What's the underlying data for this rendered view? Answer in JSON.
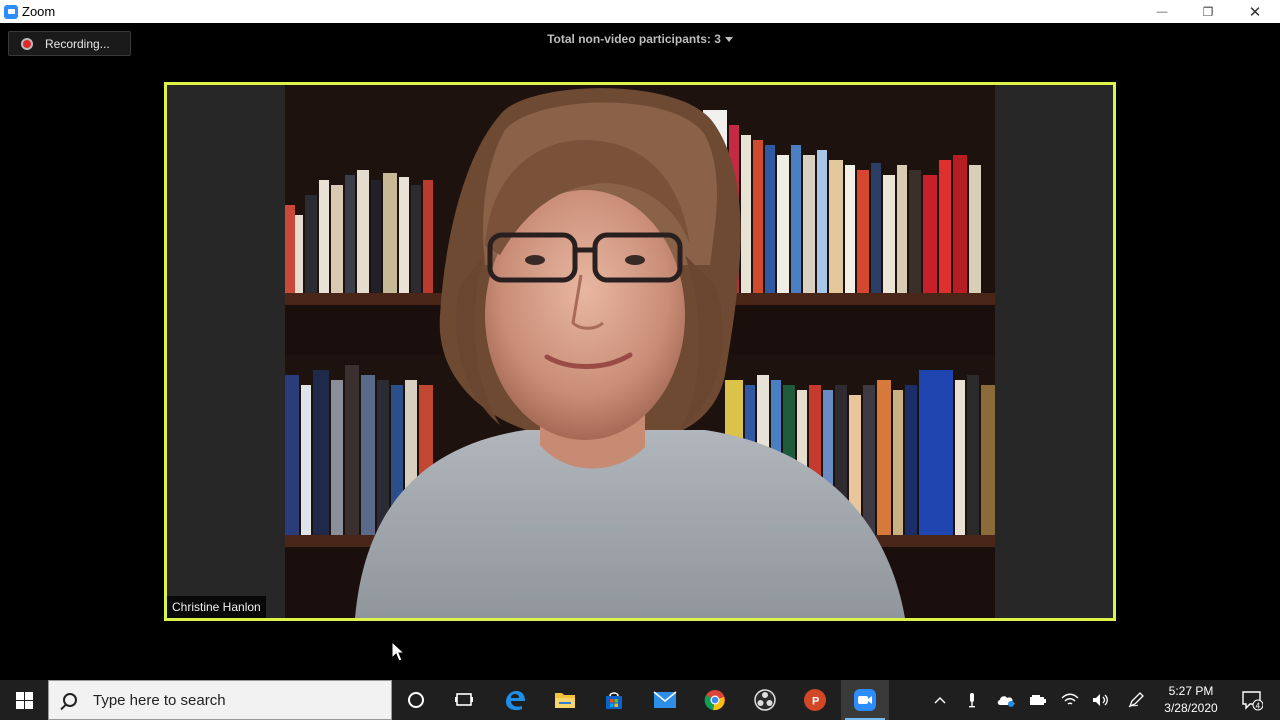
{
  "window": {
    "title": "Zoom",
    "minimize_glyph": "—",
    "restore_glyph": "❐",
    "close_glyph": "✕"
  },
  "meeting": {
    "recording_label": "Recording...",
    "participants_text": "Total non-video participants: 3",
    "speaker_name": "Christine Hanlon",
    "active_speaker_border_color": "#ddf34a"
  },
  "taskbar": {
    "search_placeholder": "Type here to search",
    "apps": [
      "cortana-icon",
      "task-view-icon",
      "edge-icon",
      "file-explorer-icon",
      "store-icon",
      "mail-icon",
      "chrome-icon",
      "obs-icon",
      "powerpoint-icon",
      "zoom-icon"
    ],
    "active_app": "zoom-icon",
    "powerpoint_letter": "P",
    "clock_time": "5:27 PM",
    "clock_date": "3/28/2020",
    "notification_count": "4",
    "tray_icons": [
      "chevron-up-icon",
      "microphone-icon",
      "onedrive-icon",
      "battery-icon",
      "wifi-icon",
      "volume-icon",
      "pen-icon"
    ]
  }
}
